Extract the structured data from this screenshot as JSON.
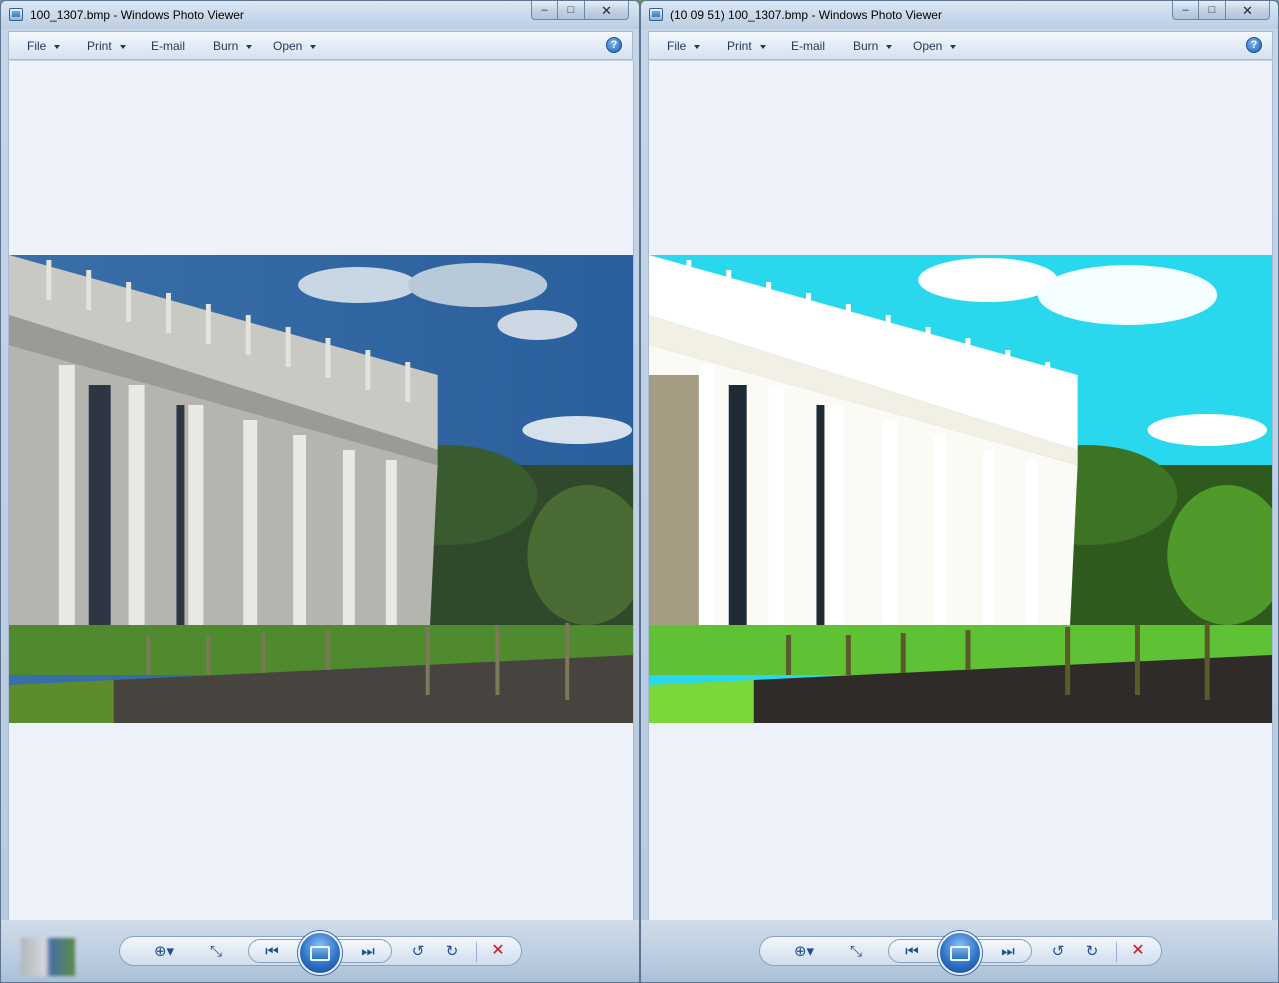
{
  "windows": [
    {
      "title": "100_1307.bmp - Windows Photo Viewer",
      "menu": [
        {
          "label": "File",
          "has_dropdown": true
        },
        {
          "label": "Print",
          "has_dropdown": true
        },
        {
          "label": "E-mail",
          "has_dropdown": false
        },
        {
          "label": "Burn",
          "has_dropdown": true
        },
        {
          "label": "Open",
          "has_dropdown": true
        }
      ],
      "help_icon": "?",
      "photo": {
        "variant": "normal",
        "description_icon": "building-photo"
      },
      "controls": {
        "zoom": "zoom-icon",
        "fit": "actual-size-icon",
        "previous": "previous-icon",
        "slideshow": "slideshow-icon",
        "next": "next-icon",
        "rotate_ccw": "rotate-counterclockwise-icon",
        "rotate_cw": "rotate-clockwise-icon",
        "delete": "delete-icon"
      }
    },
    {
      "title": "(10 09 51) 100_1307.bmp - Windows Photo Viewer",
      "menu": [
        {
          "label": "File",
          "has_dropdown": true
        },
        {
          "label": "Print",
          "has_dropdown": true
        },
        {
          "label": "E-mail",
          "has_dropdown": false
        },
        {
          "label": "Burn",
          "has_dropdown": true
        },
        {
          "label": "Open",
          "has_dropdown": true
        }
      ],
      "help_icon": "?",
      "photo": {
        "variant": "overexposed",
        "description_icon": "building-photo"
      },
      "controls": {
        "zoom": "zoom-icon",
        "fit": "actual-size-icon",
        "previous": "previous-icon",
        "slideshow": "slideshow-icon",
        "next": "next-icon",
        "rotate_ccw": "rotate-counterclockwise-icon",
        "rotate_cw": "rotate-clockwise-icon",
        "delete": "delete-icon"
      }
    }
  ],
  "caption_buttons": {
    "minimize": "–",
    "maximize": "□",
    "close": "✕"
  },
  "glyphs": {
    "zoom": "⊕▾",
    "fit": "⤡",
    "previous": "⏮",
    "next": "⏭",
    "rotate_ccw": "↺",
    "rotate_cw": "↻",
    "delete": "✕"
  },
  "colors": {
    "viewer_bg": "#edf2fa",
    "accent": "#1f4f8f",
    "delete": "#c8141e"
  }
}
